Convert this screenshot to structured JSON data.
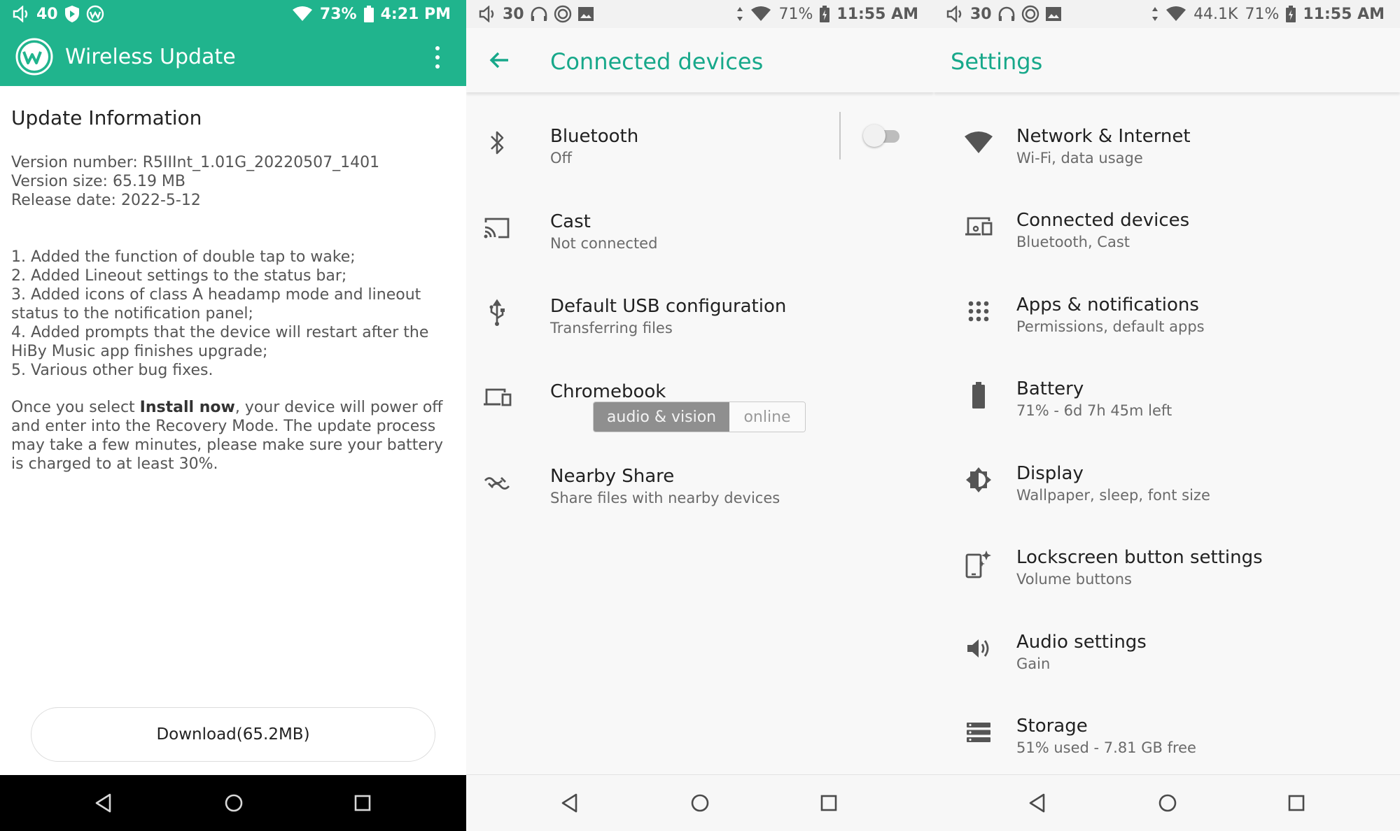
{
  "colors": {
    "accent": "#20b48d",
    "title_accent": "#17a88a"
  },
  "panel1": {
    "status": {
      "volume": "40",
      "battery": "73%",
      "time": "4:21 PM"
    },
    "app_title": "Wireless Update",
    "heading": "Update Information",
    "version_number": "Version number: R5IIInt_1.01G_20220507_1401",
    "version_size": "Version size: 65.19 MB",
    "release_date": "Release date: 2022-5-12",
    "notes": [
      "1. Added the function of double tap to wake;",
      "2. Added Lineout settings to the status bar;",
      "3. Added icons of class A headamp mode and lineout status to the notification panel;",
      "4. Added prompts that the device will restart after the HiBy Music app finishes upgrade;",
      "5. Various other bug fixes."
    ],
    "install_prefix": "Once you select ",
    "install_bold": "Install now",
    "install_suffix": ", your device will power off and enter into the Recovery Mode. The update process may take a few minutes, please make sure your battery is charged to at least 30%.",
    "download_label": "Download(65.2MB)"
  },
  "panel2": {
    "status": {
      "volume": "30",
      "battery": "71%",
      "time": "11:55 AM"
    },
    "title": "Connected devices",
    "items": [
      {
        "title": "Bluetooth",
        "subtitle": "Off",
        "icon": "bluetooth-icon"
      },
      {
        "title": "Cast",
        "subtitle": "Not connected",
        "icon": "cast-icon"
      },
      {
        "title": "Default USB configuration",
        "subtitle": "Transferring files",
        "icon": "usb-icon"
      },
      {
        "title": "Chromebook",
        "subtitle": "",
        "icon": "devices-icon"
      },
      {
        "title": "Nearby Share",
        "subtitle": "Share files with nearby devices",
        "icon": "nearby-share-icon"
      }
    ],
    "bluetooth_toggle": "off",
    "watermark": {
      "left": "audio & vision",
      "right": "online"
    }
  },
  "panel3": {
    "status": {
      "volume": "30",
      "speed": "44.1K",
      "battery": "71%",
      "time": "11:55 AM"
    },
    "title": "Settings",
    "items": [
      {
        "title": "Network & Internet",
        "subtitle": "Wi-Fi, data usage",
        "icon": "wifi-icon"
      },
      {
        "title": "Connected devices",
        "subtitle": "Bluetooth, Cast",
        "icon": "connected-devices-icon"
      },
      {
        "title": "Apps & notifications",
        "subtitle": "Permissions, default apps",
        "icon": "apps-grid-icon"
      },
      {
        "title": "Battery",
        "subtitle": "71% - 6d 7h 45m left",
        "icon": "battery-icon"
      },
      {
        "title": "Display",
        "subtitle": "Wallpaper, sleep, font size",
        "icon": "brightness-icon"
      },
      {
        "title": "Lockscreen button settings",
        "subtitle": "Volume buttons",
        "icon": "lockscreen-icon"
      },
      {
        "title": "Audio settings",
        "subtitle": "Gain",
        "icon": "speaker-icon"
      },
      {
        "title": "Storage",
        "subtitle": "51% used - 7.81 GB free",
        "icon": "storage-icon"
      }
    ]
  }
}
